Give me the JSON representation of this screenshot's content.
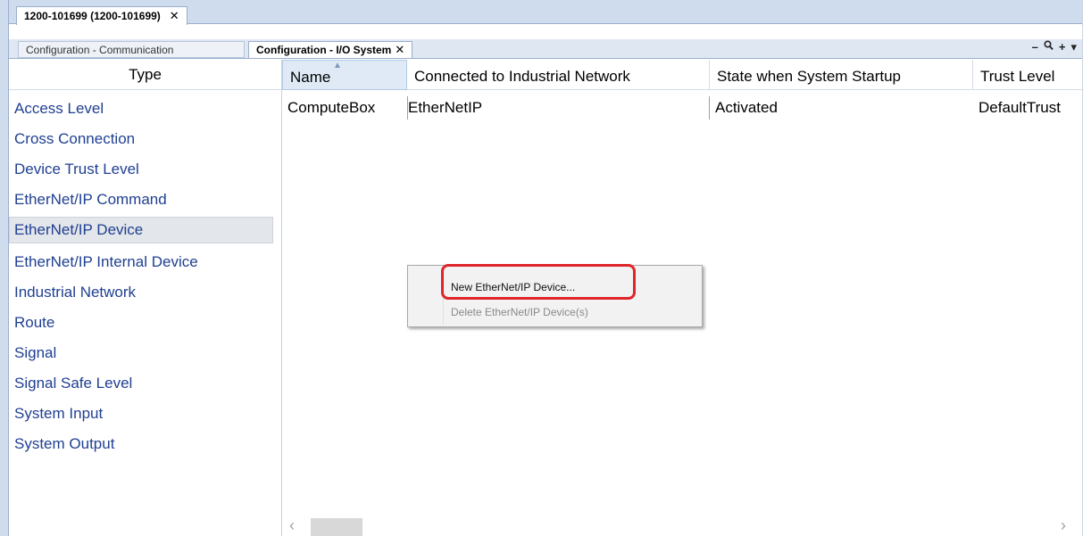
{
  "doc_tab": {
    "title": "1200-101699 (1200-101699)",
    "close": "✕"
  },
  "sub_tabs": {
    "communication": "Configuration - Communication",
    "io_system": "Configuration - I/O System",
    "close": "✕"
  },
  "tab_tools": {
    "minimize": "–",
    "search": "🔍",
    "add": "+",
    "more": "▾"
  },
  "type_pane": {
    "header": "Type",
    "items": [
      "Access Level",
      "Cross Connection",
      "Device Trust Level",
      "EtherNet/IP Command",
      "EtherNet/IP Device",
      "EtherNet/IP Internal Device",
      "Industrial Network",
      "Route",
      "Signal",
      "Signal Safe Level",
      "System Input",
      "System Output"
    ],
    "selected_index": 4
  },
  "grid": {
    "columns": [
      "Name",
      "Connected to Industrial Network",
      "State when System Startup",
      "Trust Level"
    ],
    "rows": [
      [
        "ComputeBox",
        "EtherNetIP",
        "Activated",
        "DefaultTrust"
      ]
    ]
  },
  "scrollbar": {
    "left": "‹",
    "right": "›"
  },
  "context_menu": {
    "new_device": "New EtherNet/IP Device...",
    "delete_device": "Delete EtherNet/IP Device(s)"
  },
  "colors": {
    "highlight": "#e0252a",
    "link_text": "#1f3f91"
  }
}
